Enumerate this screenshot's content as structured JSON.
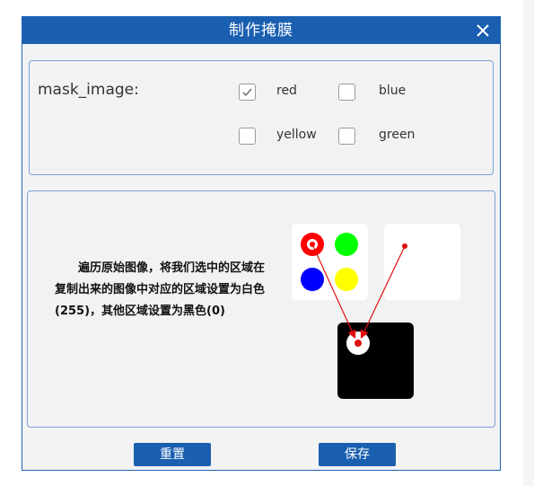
{
  "dialog": {
    "title": "制作掩膜",
    "close_icon": "close-icon"
  },
  "mask": {
    "label": "mask_image:",
    "options": [
      {
        "label": "red",
        "checked": true
      },
      {
        "label": "blue",
        "checked": false
      },
      {
        "label": "yellow",
        "checked": false
      },
      {
        "label": "green",
        "checked": false
      }
    ]
  },
  "description": "遍历原始图像，将我们选中的区域在复制出来的图像中对应的区域设置为白色(255)，其他区域设置为黑色(0)",
  "colors": {
    "accent": "#1a5fb0",
    "red": "#ff0000",
    "green": "#00ff00",
    "blue": "#0000ff",
    "yellow": "#ffff00"
  },
  "buttons": {
    "reset": "重置",
    "save": "保存"
  }
}
